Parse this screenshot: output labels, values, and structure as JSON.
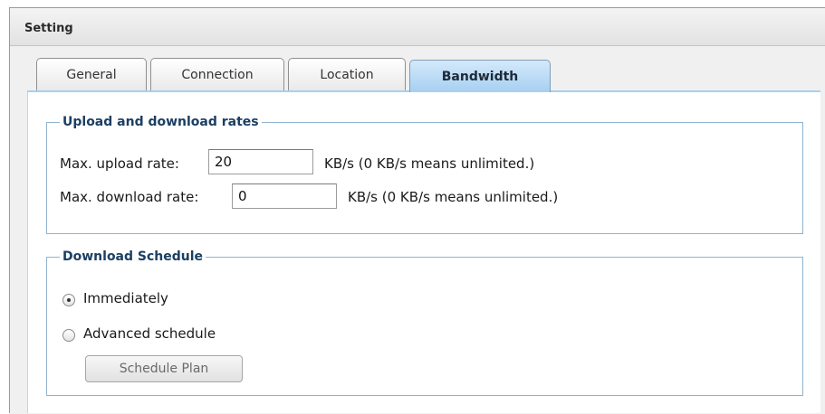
{
  "header": {
    "title": "Setting"
  },
  "tabs": [
    {
      "label": "General",
      "active": false
    },
    {
      "label": "Connection",
      "active": false
    },
    {
      "label": "Location",
      "active": false
    },
    {
      "label": "Bandwidth",
      "active": true
    }
  ],
  "rates": {
    "legend": "Upload and download rates",
    "upload": {
      "label": "Max. upload rate:",
      "value": "20",
      "unit_note": "KB/s (0 KB/s means unlimited.)"
    },
    "download": {
      "label": "Max. download rate:",
      "value": "0",
      "unit_note": "KB/s (0 KB/s means unlimited.)"
    }
  },
  "schedule": {
    "legend": "Download Schedule",
    "options": [
      {
        "label": "Immediately",
        "checked": true
      },
      {
        "label": "Advanced schedule",
        "checked": false
      }
    ],
    "plan_button": "Schedule Plan"
  },
  "colors": {
    "active_tab": "#a7cff1",
    "legend_text": "#1b3f63",
    "fieldset_border": "#8fb3cf"
  }
}
